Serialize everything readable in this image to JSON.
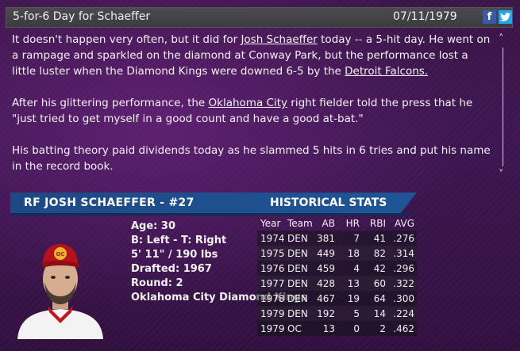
{
  "header": {
    "title": "5-for-6 Day for Schaeffer",
    "date": "07/11/1979",
    "facebook_glyph": "f",
    "twitter_glyph": "🐦"
  },
  "article": {
    "p1_a": "It doesn't happen very often, but it did for ",
    "p1_link1": "Josh Schaeffer",
    "p1_b": " today -- a 5-hit day. He went on a rampage and sparkled on the diamond at Conway Park, but the performance lost a little luster when the Diamond Kings were downed 6-5 by the ",
    "p1_link2": "Detroit Falcons.",
    "p2_a": "After his glittering performance, the ",
    "p2_link": "Oklahoma City",
    "p2_b": " right fielder told the press that he \"just tried to get myself in a good count and have a good at-bat.\"",
    "p3": "His batting theory paid dividends today as he slammed 5 hits in 6 tries and put his name in the record book."
  },
  "scroll": {
    "up": "˄",
    "down": "˅"
  },
  "player": {
    "banner": "RF JOSH SCHAEFFER - #27",
    "cap_logo": "OC",
    "age": "Age: 30",
    "bats_throws": "B: Left - T: Right",
    "height_weight": "5' 11\" / 190 lbs",
    "drafted": "Drafted: 1967",
    "round": "Round: 2",
    "team": "Oklahoma City Diamond Kings"
  },
  "stats": {
    "heading": "HISTORICAL STATS",
    "columns": [
      "Year",
      "Team",
      "AB",
      "HR",
      "RBI",
      "AVG"
    ],
    "rows": [
      [
        "1974",
        "DEN",
        "381",
        "7",
        "41",
        ".276"
      ],
      [
        "1975",
        "DEN",
        "449",
        "18",
        "82",
        ".314"
      ],
      [
        "1976",
        "DEN",
        "459",
        "4",
        "42",
        ".296"
      ],
      [
        "1977",
        "DEN",
        "428",
        "13",
        "60",
        ".322"
      ],
      [
        "1978",
        "DEN",
        "467",
        "19",
        "64",
        ".300"
      ],
      [
        "1979",
        "DEN",
        "192",
        "5",
        "14",
        ".224"
      ],
      [
        "1979",
        "OC",
        "13",
        "0",
        "2",
        ".462"
      ]
    ]
  },
  "colors": {
    "banner": "#1f5596",
    "background": "#3d1650",
    "facebook": "#3b5aa0",
    "twitter": "#2aa4e8"
  }
}
